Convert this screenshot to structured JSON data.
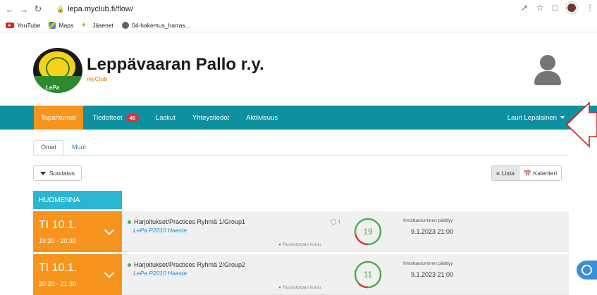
{
  "browser": {
    "url": "lepa.myclub.fi/flow/",
    "bookmarks": [
      "YouTube",
      "Maps",
      "Jäsenet",
      "04-hakemus_harras..."
    ]
  },
  "header": {
    "club_name": "Leppävaaran Pallo r.y.",
    "sub": "myClub",
    "logo_text": "LePa"
  },
  "nav": {
    "items": [
      {
        "label": "Tapahtumat",
        "active": true
      },
      {
        "label": "Tiedotteet",
        "badge": "45"
      },
      {
        "label": "Laskut"
      },
      {
        "label": "Yhteystiedot"
      },
      {
        "label": "Aktiivisuus"
      }
    ],
    "user": "Lauri Lepalainen"
  },
  "tabs": {
    "own": "Omat",
    "other": "Muut"
  },
  "toolbar": {
    "filter": "Suodatus",
    "list": "Lista",
    "calendar": "Kalenteri"
  },
  "day_header": "HUOMENNA",
  "events": [
    {
      "day": "TI 10.1.",
      "time": "19:20 - 20:30",
      "title": "Harjoitukset/Practices Ryhmä 1/Group1",
      "team": "LePa P2010 Haaste",
      "comments": "1",
      "location": "Ruusutorpan koulu",
      "count": "19",
      "reg_label": "Ilmoittautuminen päättyy",
      "reg_date": "9.1.2023 21:00"
    },
    {
      "day": "TI 10.1.",
      "time": "20:20 - 21:30",
      "title": "Harjoitukset/Practices Ryhmä 2/Group2",
      "team": "LePa P2010 Haaste",
      "comments": "",
      "location": "Ruusutorpan koulu",
      "count": "11",
      "reg_label": "Ilmoittautuminen päättyy",
      "reg_date": "9.1.2023 21:00"
    }
  ],
  "colors": {
    "nav": "#0e90a0",
    "accent": "#f7941d",
    "day_header": "#29b6d4"
  }
}
